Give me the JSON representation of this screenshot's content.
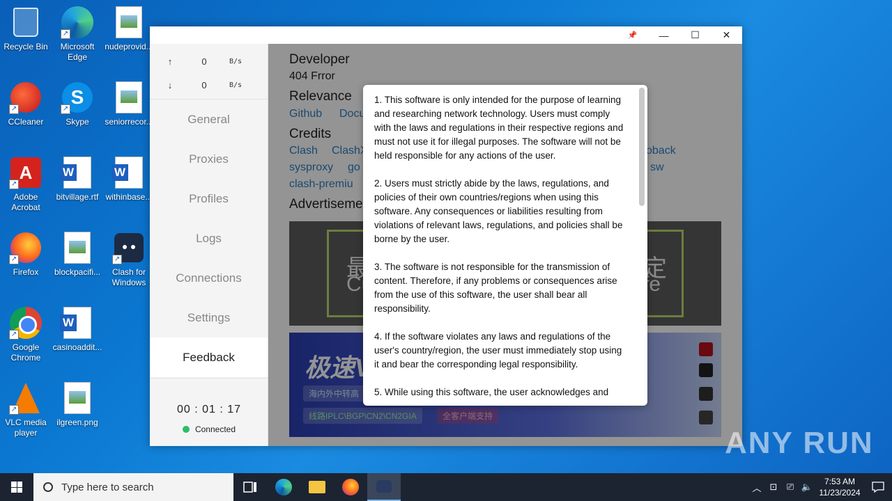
{
  "desktop": {
    "icons": [
      {
        "label": "Recycle Bin"
      },
      {
        "label": "Microsoft Edge"
      },
      {
        "label": "nudeprovid..."
      },
      {
        "label": "CCleaner"
      },
      {
        "label": "Skype"
      },
      {
        "label": "seniorrecor..."
      },
      {
        "label": "Adobe Acrobat"
      },
      {
        "label": "bitvillage.rtf"
      },
      {
        "label": "withinbase..."
      },
      {
        "label": "Firefox"
      },
      {
        "label": "blockpacifi..."
      },
      {
        "label": "Clash for Windows"
      },
      {
        "label": "Google Chrome"
      },
      {
        "label": "casinoaddit..."
      },
      {
        "label": "VLC media player"
      },
      {
        "label": "ilgreen.png"
      }
    ],
    "watermark": "ANY RUN"
  },
  "window": {
    "controls": {
      "pin": "📌",
      "minimize": "—",
      "maximize": "☐",
      "close": "✕"
    },
    "traffic": {
      "up_arrow": "↑",
      "up_value": "0",
      "up_unit": "B/s",
      "down_arrow": "↓",
      "down_value": "0",
      "down_unit": "B/s"
    },
    "nav": [
      {
        "label": "General"
      },
      {
        "label": "Proxies"
      },
      {
        "label": "Profiles"
      },
      {
        "label": "Logs"
      },
      {
        "label": "Connections"
      },
      {
        "label": "Settings"
      },
      {
        "label": "Feedback"
      }
    ],
    "clock": "00 : 01 : 17",
    "status": "Connected",
    "content": {
      "developer_title": "Developer",
      "developer_name": "404 Frror",
      "relevance_title": "Relevance",
      "relevance_links": [
        "Github",
        "Docu"
      ],
      "credits_title": "Credits",
      "credits_row1": [
        "Clash",
        "ClashX"
      ],
      "credits_row1_right": "oback",
      "credits_row2": [
        "sysproxy",
        "go"
      ],
      "credits_row2_right": "sw",
      "credits_row3": "clash-premiu",
      "advert_title": "Advertiseme",
      "ad1_left_top": "最",
      "ad1_left_bottom": "Cu",
      "ad1_right_top": "定",
      "ad1_right_bottom": "fe",
      "ad2_title": "极速V",
      "ad2_tag1": "海内外中转高",
      "ad2_tag2": "线路IPLC\\BGP\\CN2\\CN2GIA",
      "ad2_tag3": "全客户端支持"
    },
    "modal": {
      "paragraphs": [
        "1. This software is only intended for the purpose of learning and researching network technology. Users must comply with the laws and regulations in their respective regions and must not use it for illegal purposes. The software will not be held responsible for any actions of the user.",
        "2. Users must strictly abide by the laws, regulations, and policies of their own countries/regions when using this software. Any consequences or liabilities resulting from violations of relevant laws, regulations, and policies shall be borne by the user.",
        "3. The software is not responsible for the transmission of content. Therefore, if any problems or consequences arise from the use of this software, the user shall bear all responsibility.",
        "4. If the software violates any laws and regulations of the user's country/region, the user must immediately stop using it and bear the corresponding legal responsibility.",
        "5. While using this software, the user acknowledges and"
      ]
    }
  },
  "taskbar": {
    "search_placeholder": "Type here to search",
    "time": "7:53 AM",
    "date": "11/23/2024"
  },
  "colors": {
    "accent_link": "#2f7fbf",
    "status_green": "#2ebd6b",
    "taskbar": "#1c2432"
  }
}
